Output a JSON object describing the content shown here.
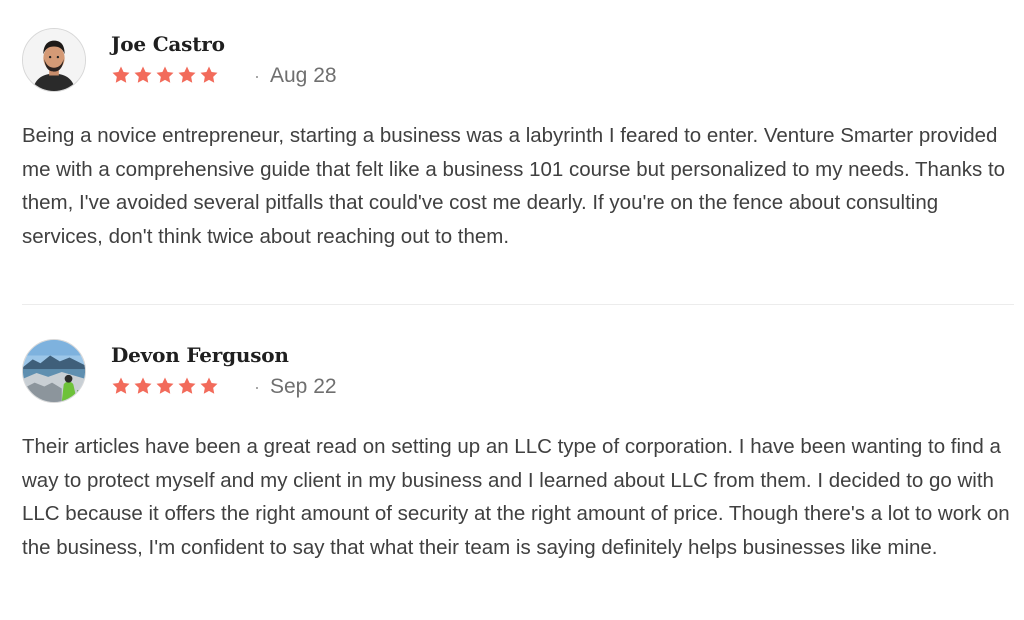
{
  "reviews": [
    {
      "name": "Joe Castro",
      "rating": 5,
      "date": "Aug 28",
      "date_separator": "·",
      "text": "Being a novice entrepreneur, starting a business was a labyrinth I feared to enter. Venture Smarter provided me with a comprehensive guide that felt like a business 101 course but personalized to my needs. Thanks to them, I've avoided several pitfalls that could've cost me dearly. If you're on the fence about consulting services, don't think twice about reaching out to them.",
      "avatar_icon": "person-portrait-icon"
    },
    {
      "name": "Devon Ferguson",
      "rating": 5,
      "date": "Sep 22",
      "date_separator": "·",
      "text": "Their articles have been a great read on setting up an LLC type of corporation. I have been wanting to find a way to protect myself and my client in my business and I learned about LLC from them. I decided to go with LLC because it offers the right amount of security at the right amount of price. Though there's a lot to work on the business, I'm confident to say that what their team is saying definitely helps businesses like mine.",
      "avatar_icon": "landscape-photo-icon"
    }
  ],
  "colors": {
    "star": "#f26b5b",
    "name": "#1f1f1f",
    "body_text": "#404040",
    "date": "#6f6f6f",
    "divider": "#ececec"
  }
}
